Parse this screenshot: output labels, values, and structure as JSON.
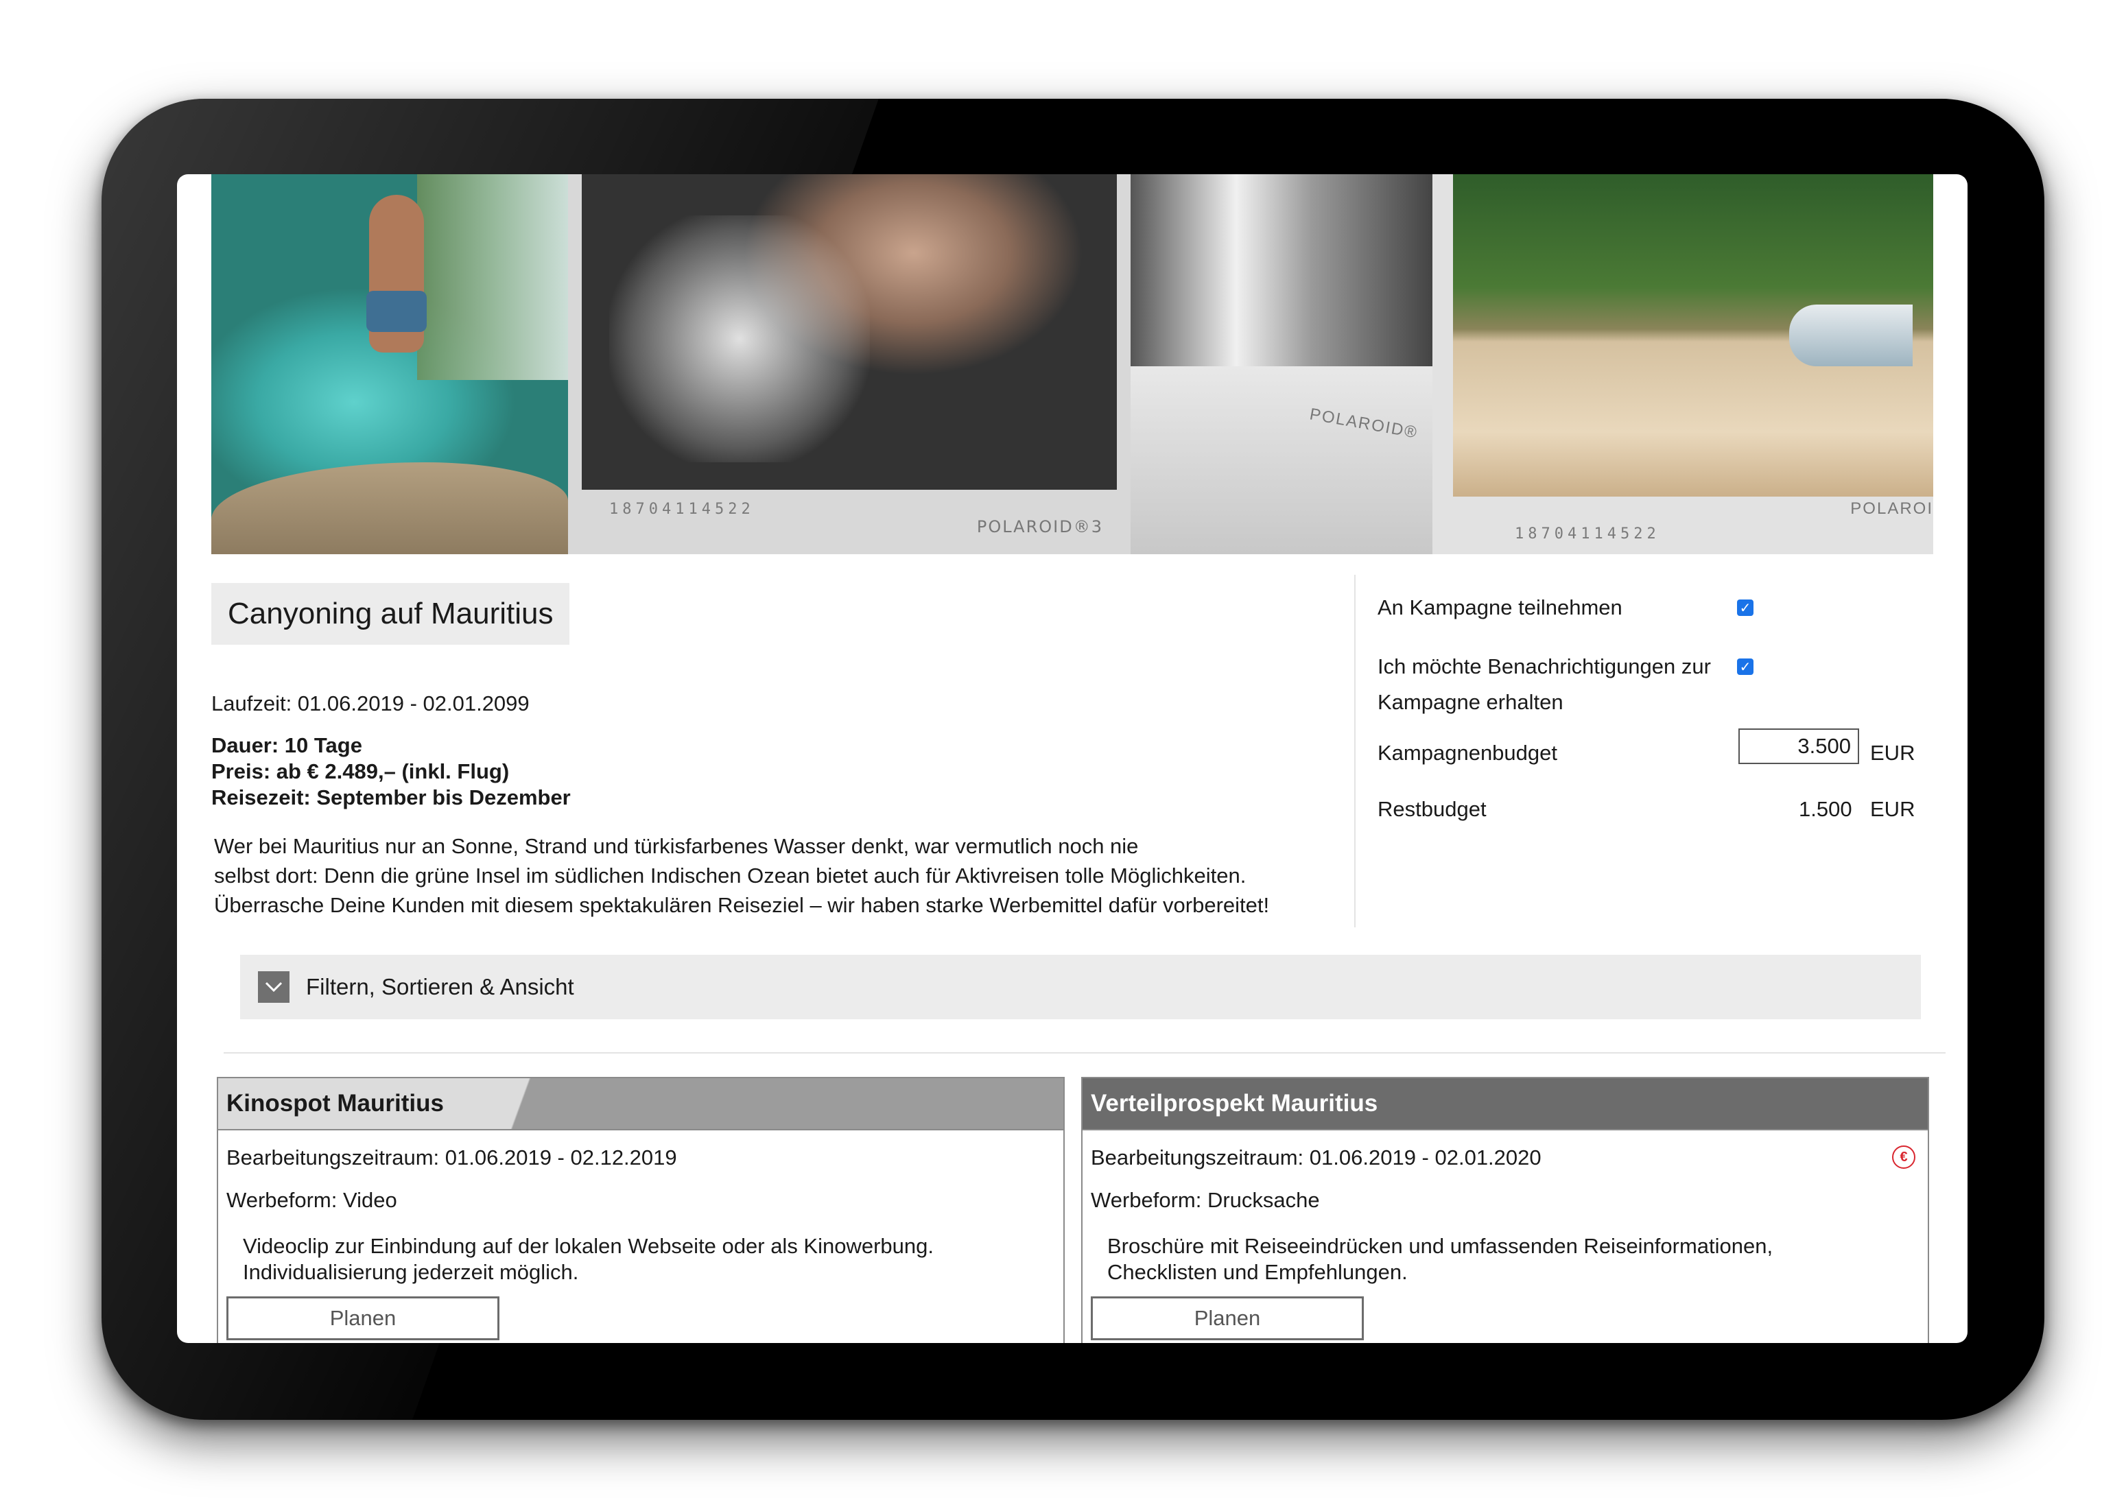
{
  "campaign": {
    "title": "Canyoning auf Mauritius",
    "runtime": "Laufzeit: 01.06.2019 - 02.01.2099",
    "duration": "Dauer: 10 Tage",
    "price": "Preis: ab € 2.489,– (inkl. Flug)",
    "travel_time": "Reisezeit: September bis Dezember",
    "description_lines": [
      "Wer bei Mauritius nur an Sonne, Strand und türkisfarbenes Wasser denkt, war vermutlich noch nie",
      "selbst dort: Denn die grüne Insel im südlichen Indischen Ozean bietet auch für Aktivreisen tolle Möglichkeiten.",
      "Überrasche Deine Kunden mit diesem spektakulären Reiseziel – wir haben starke Werbemittel dafür vorbereitet!"
    ]
  },
  "hero": {
    "photo_numbers": [
      "18704114522",
      "18704114522"
    ],
    "photo_brands": [
      "POLAROID®3",
      "POLAROID®",
      "POLAROI"
    ]
  },
  "settings": {
    "participate_label": "An Kampagne teilnehmen",
    "participate_checked": true,
    "notify_label_line1": "Ich möchte Benachrichtigungen zur",
    "notify_label_line2": "Kampagne erhalten",
    "notify_checked": true,
    "budget_label": "Kampagnenbudget",
    "budget_value": "3.500",
    "budget_currency": "EUR",
    "rest_label": "Restbudget",
    "rest_value": "1.500",
    "rest_currency": "EUR",
    "checkbox_color": "#1a73e8"
  },
  "filter": {
    "label": "Filtern, Sortieren & Ansicht",
    "icon": "chevron-down-icon"
  },
  "cards": [
    {
      "title": "Kinospot Mauritius",
      "period": "Bearbeitungszeitraum: 01.06.2019 - 02.12.2019",
      "form": "Werbeform: Video",
      "desc_line1": "Videoclip zur Einbindung auf der lokalen Webseite oder als Kinowerbung.",
      "desc_line2": "Individualisierung jederzeit möglich.",
      "button": "Planen"
    },
    {
      "title": "Verteilprospekt Mauritius",
      "period": "Bearbeitungszeitraum: 01.06.2019 - 02.01.2020",
      "form": "Werbeform: Drucksache",
      "desc_line1": "Broschüre mit Reiseeindrücken und umfassenden Reiseinformationen,",
      "desc_line2": "Checklisten und Empfehlungen.",
      "button": "Planen",
      "badge_icon": "euro-icon",
      "badge_glyph": "€",
      "badge_color": "#d9262f"
    }
  ]
}
